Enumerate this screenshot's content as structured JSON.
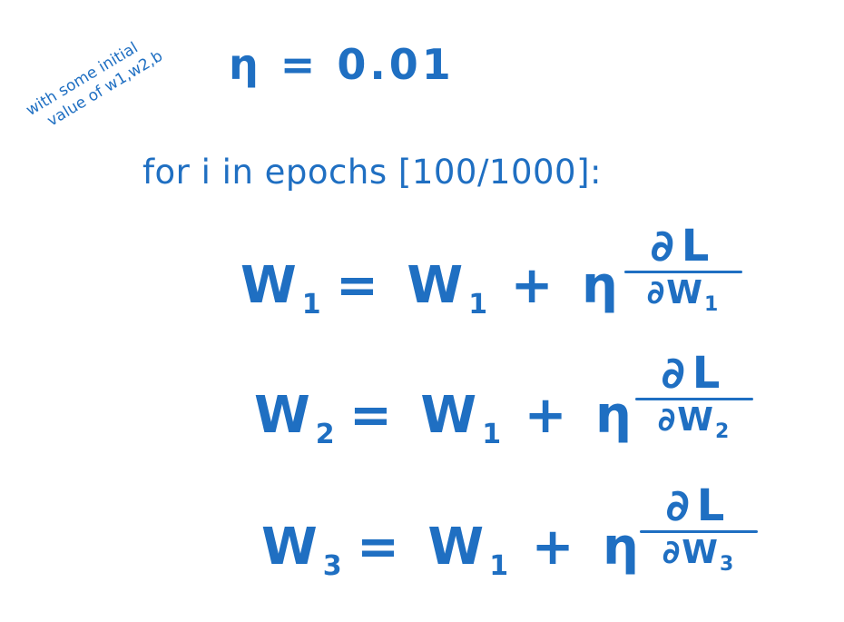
{
  "side_note": {
    "line1": "with some initial",
    "line2": "value of w1,w2,b"
  },
  "eta_assignment": "η = 0.01",
  "loop_header": "for i in epochs [100/1000]:",
  "equations": [
    {
      "lhs_var": "W",
      "lhs_sub": "1",
      "rhs_prefix": "= W",
      "rhs_sub": "1",
      "rhs_suffix": "+ η",
      "numerator": "∂L",
      "denominator_var": "∂W",
      "denominator_sub": "1"
    },
    {
      "lhs_var": "W",
      "lhs_sub": "2",
      "rhs_prefix": "= W",
      "rhs_sub": "1",
      "rhs_suffix": "+ η",
      "numerator": "∂L",
      "denominator_var": "∂W",
      "denominator_sub": "2"
    },
    {
      "lhs_var": "W",
      "lhs_sub": "3",
      "rhs_prefix": "= W",
      "rhs_sub": "1",
      "rhs_suffix": "+ η",
      "numerator": "∂L",
      "denominator_var": "∂W",
      "denominator_sub": "3"
    }
  ],
  "colors": {
    "ink": "#1f6fc2",
    "background": "#ffffff"
  }
}
